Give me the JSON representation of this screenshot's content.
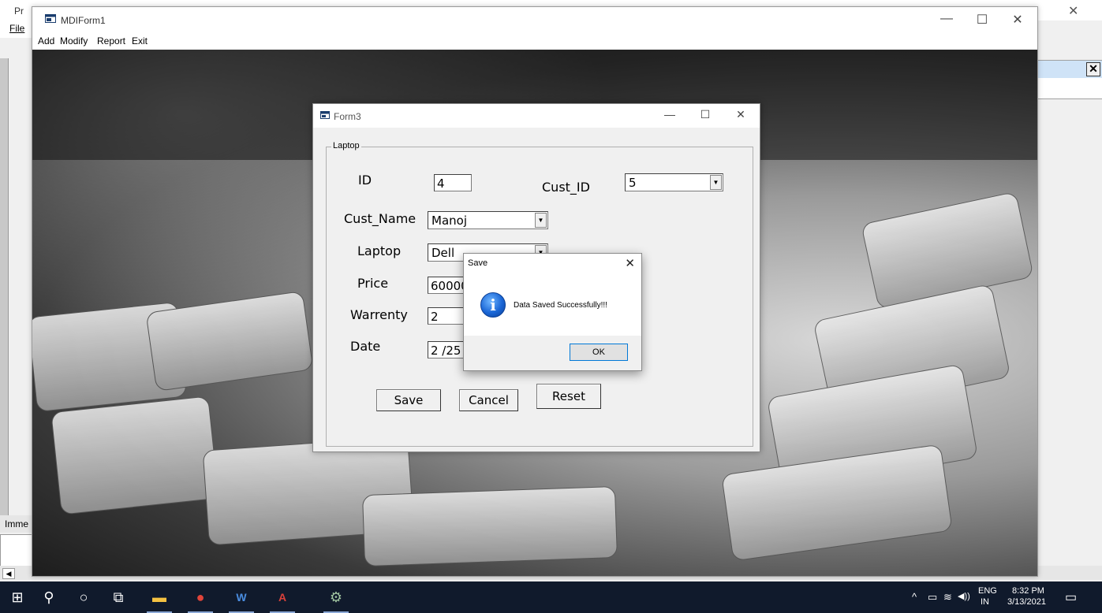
{
  "ide": {
    "title_fragment": "Pr",
    "menu_file": "File",
    "immediate_label": "Imme",
    "close_glyph": "✕"
  },
  "mdi": {
    "title": "MDIForm1",
    "menu": [
      "Add",
      "Modify",
      "Report",
      "Exit"
    ],
    "controls": {
      "minimize": "—",
      "maximize": "☐",
      "close": "✕"
    }
  },
  "form3": {
    "title": "Form3",
    "controls": {
      "minimize": "—",
      "maximize": "☐",
      "close": "✕"
    },
    "frame_label": "Laptop",
    "fields": {
      "id": {
        "label": "ID",
        "value": "4"
      },
      "cust_id": {
        "label": "Cust_ID",
        "value": "5"
      },
      "cust_name": {
        "label": "Cust_Name",
        "value": "Manoj"
      },
      "laptop": {
        "label": "Laptop",
        "value": "Dell"
      },
      "price": {
        "label": "Price",
        "value": "60000"
      },
      "warrenty": {
        "label": "Warrenty",
        "value": "2"
      },
      "date": {
        "label": "Date",
        "value": "2 /25"
      }
    },
    "buttons": {
      "save": "Save",
      "cancel": "Cancel",
      "reset": "Reset"
    }
  },
  "msgbox": {
    "title": "Save",
    "close": "✕",
    "icon": "information-icon",
    "icon_glyph": "i",
    "message": "Data Saved Successfully!!!",
    "ok": "OK"
  },
  "taskbar": {
    "icons": [
      "windows-start-icon",
      "search-icon",
      "cortana-icon",
      "task-view-icon",
      "file-explorer-icon",
      "chrome-icon",
      "word-icon",
      "access-icon",
      "vb6-icon"
    ],
    "glyphs": {
      "start": "⊞",
      "search": "⚲",
      "cortana": "○",
      "taskview": "⧉",
      "explorer": "▬",
      "chrome": "●",
      "word": "W",
      "access": "A",
      "vb": "⚙"
    },
    "tray": {
      "chevron": "^",
      "battery_glyph": "▭",
      "wifi_glyph": "≋",
      "volume_glyph": "◀))",
      "lang_top": "ENG",
      "lang_bottom": "IN",
      "time": "8:32 PM",
      "date": "3/13/2021",
      "notification_glyph": "▭"
    }
  },
  "colors": {
    "taskbar_bg": "#101a2c",
    "focus_border": "#0078d7",
    "info_icon": "#1a66d6"
  }
}
